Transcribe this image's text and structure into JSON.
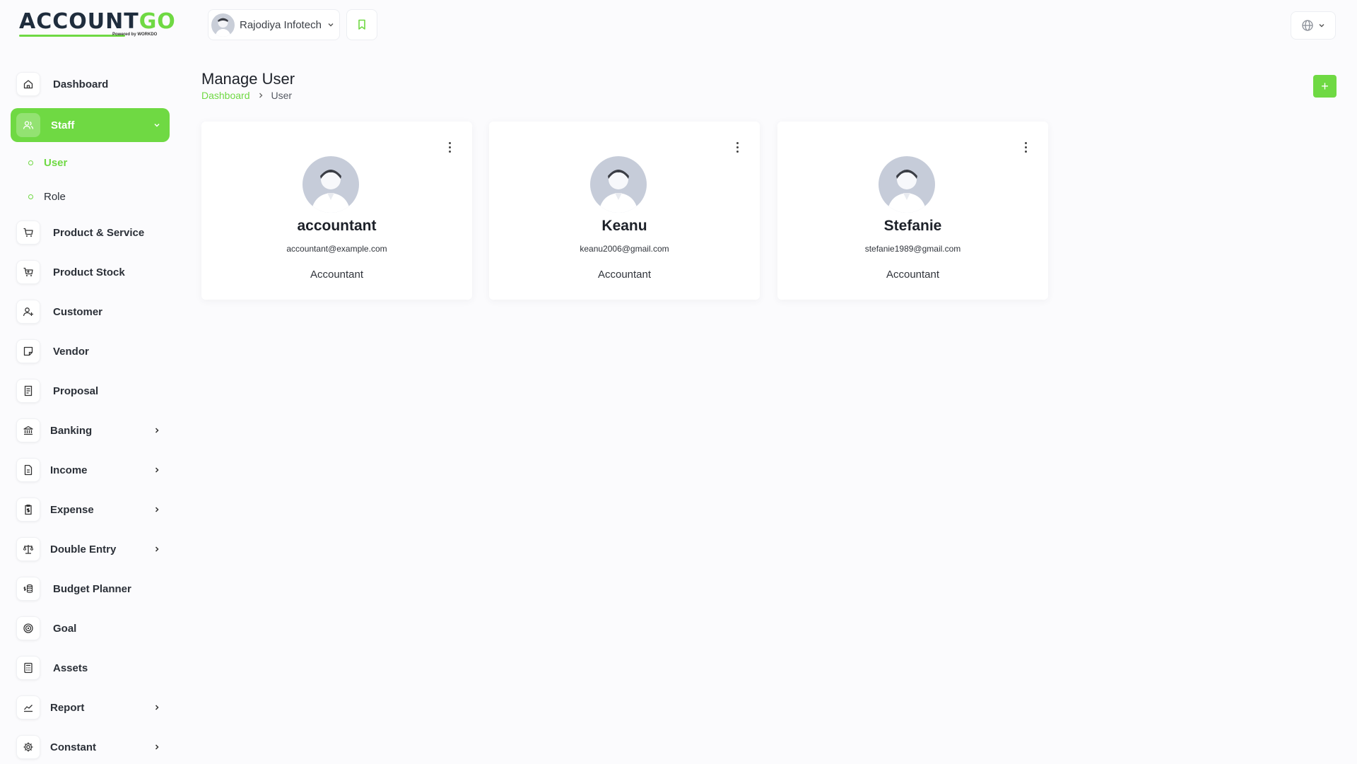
{
  "brand": {
    "logo_main": "ACCOUNT",
    "logo_accent": "GO",
    "logo_sub": "Powered by WORKDO"
  },
  "topbar": {
    "company_name": "Rajodiya Infotech"
  },
  "sidebar": {
    "items": [
      {
        "label": "Dashboard",
        "icon": "home-icon"
      },
      {
        "label": "Staff",
        "icon": "users-icon",
        "active": true
      },
      {
        "label": "Product & Service",
        "icon": "cart-icon"
      },
      {
        "label": "Product Stock",
        "icon": "cart-stock-icon"
      },
      {
        "label": "Customer",
        "icon": "user-plus-icon"
      },
      {
        "label": "Vendor",
        "icon": "note-icon"
      },
      {
        "label": "Proposal",
        "icon": "receipt-icon"
      },
      {
        "label": "Banking",
        "icon": "bank-icon"
      },
      {
        "label": "Income",
        "icon": "file-icon"
      },
      {
        "label": "Expense",
        "icon": "clipboard-dollar-icon"
      },
      {
        "label": "Double Entry",
        "icon": "scale-icon"
      },
      {
        "label": "Budget Planner",
        "icon": "coins-icon"
      },
      {
        "label": "Goal",
        "icon": "target-icon"
      },
      {
        "label": "Assets",
        "icon": "calculator-icon"
      },
      {
        "label": "Report",
        "icon": "chart-line-icon"
      },
      {
        "label": "Constant",
        "icon": "gear-icon"
      }
    ],
    "sub_items": [
      {
        "label": "User",
        "active": true
      },
      {
        "label": "Role"
      }
    ]
  },
  "page": {
    "title": "Manage User",
    "breadcrumb": [
      "Dashboard",
      "User"
    ],
    "add_button": "+"
  },
  "users": [
    {
      "name": "accountant",
      "email": "accountant@example.com",
      "role": "Accountant"
    },
    {
      "name": "Keanu",
      "email": "keanu2006@gmail.com",
      "role": "Accountant"
    },
    {
      "name": "Stefanie",
      "email": "stefanie1989@gmail.com",
      "role": "Accountant"
    }
  ],
  "colors": {
    "accent": "#6fd943",
    "background": "#fbfbfd"
  }
}
